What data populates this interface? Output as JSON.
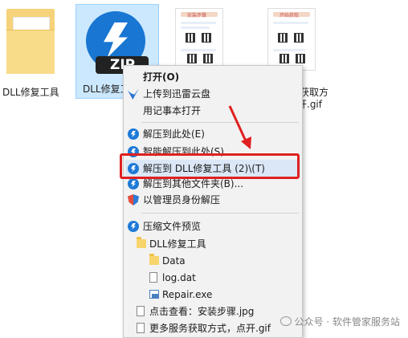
{
  "desktop": {
    "files": [
      {
        "label": "DLL修复工具"
      },
      {
        "label": "DLL修复工"
      },
      {
        "label": "获取方"
      },
      {
        "label": "开.gif"
      }
    ],
    "zip_badge": "ZIP",
    "thumb1_title": "安装步骤",
    "thumb2_title": "开始获取"
  },
  "menu": {
    "open": "打开(O)",
    "upload": "上传到迅雷云盘",
    "notepad": "用记事本打开",
    "extract_here": "解压到此处(E)",
    "smart_extract": "智能解压到此处(S)",
    "extract_to": "解压到 DLL修复工具 (2)\\(T)",
    "extract_other": "解压到其他文件夹(B)...",
    "admin_extract": "以管理员身份解压",
    "preview_header": "压缩文件预览",
    "tree": {
      "root": "DLL修复工具",
      "data": "Data",
      "log": "log.dat",
      "repair": "Repair.exe",
      "jpg": "点击查看：安装步骤.jpg",
      "gif": "更多服务获取方式，点开.gif"
    }
  },
  "watermark": "公众号 · 软件管家服务站",
  "colors": {
    "highlight_border": "#e02020",
    "menu_bg": "#f2f2f2",
    "selection": "#cce8ff",
    "icon_blue": "#1e7ad6"
  }
}
